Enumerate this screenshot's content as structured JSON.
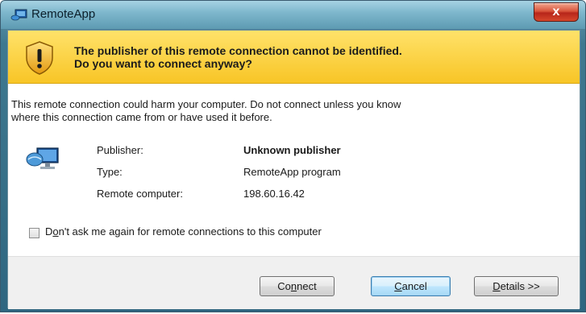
{
  "window": {
    "title": "RemoteApp",
    "close_label": "x"
  },
  "banner": {
    "line1": "The publisher of this remote connection cannot be identified.",
    "line2": "Do you want to connect anyway?"
  },
  "warning": {
    "line1": "This remote connection could harm your computer. Do not connect unless you know",
    "line2": "where this connection came from or have used it before."
  },
  "info": {
    "publisher_label": "Publisher:",
    "publisher_value": "Unknown publisher",
    "type_label": "Type:",
    "type_value": "RemoteApp program",
    "remote_label": "Remote computer:",
    "remote_value": "198.60.16.42"
  },
  "checkbox": {
    "label_prefix": "D",
    "label_accel": "o",
    "label_rest": "n't ask me again for remote connections to this computer",
    "checked": false
  },
  "buttons": {
    "connect_prefix": "Co",
    "connect_accel": "n",
    "connect_rest": "nect",
    "cancel_prefix": "",
    "cancel_accel": "C",
    "cancel_rest": "ancel",
    "details_prefix": "",
    "details_accel": "D",
    "details_rest": "etails >>"
  },
  "colors": {
    "banner": "#f8c526",
    "titlebar": "#7fb8cd",
    "close": "#c8382a"
  }
}
